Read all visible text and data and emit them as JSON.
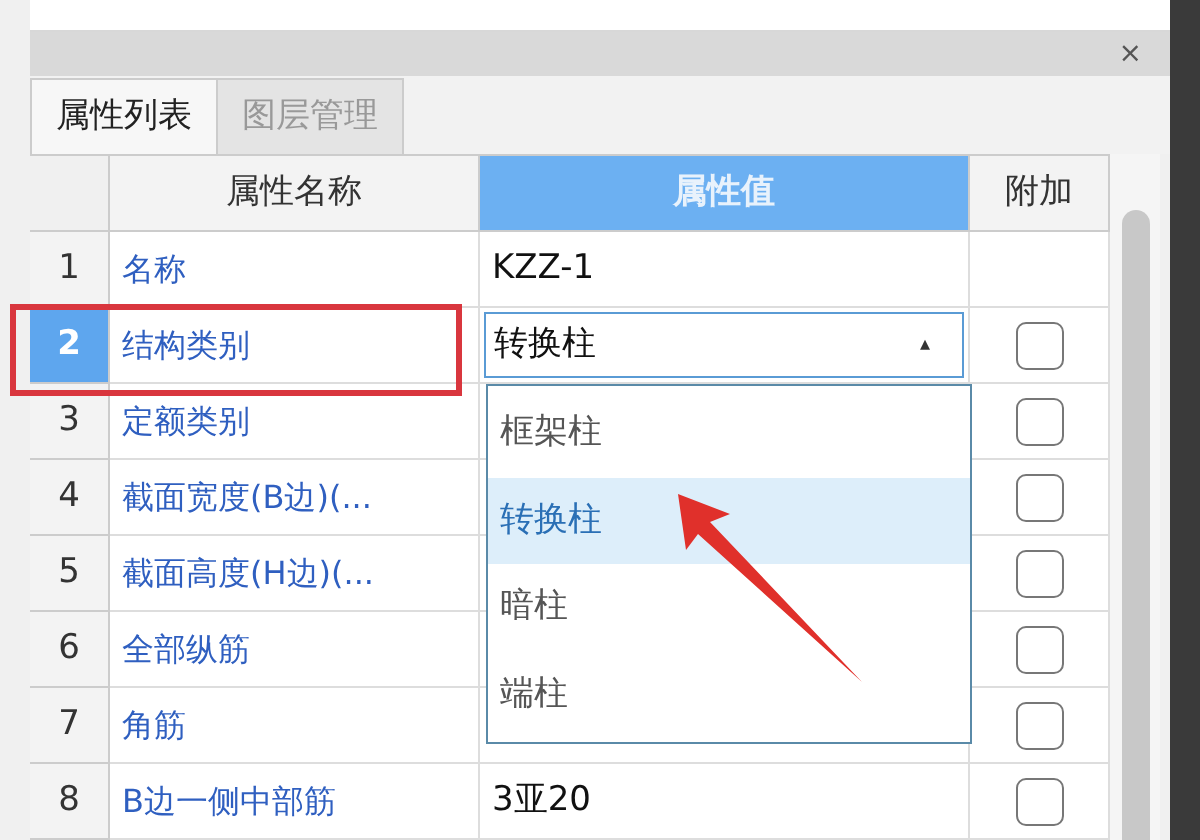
{
  "panel": {
    "close": "×"
  },
  "tabs": [
    {
      "label": "属性列表",
      "selected": true
    },
    {
      "label": "图层管理",
      "selected": false
    }
  ],
  "table": {
    "columns": [
      {
        "label": "属性名称",
        "selected": false
      },
      {
        "label": "属性值",
        "selected": true
      },
      {
        "label": "附加",
        "selected": false
      }
    ],
    "rows": [
      {
        "num": "1",
        "name": "名称",
        "value": "KZZ-1",
        "selected": false
      },
      {
        "num": "2",
        "name": "结构类别",
        "value": "转换柱",
        "selected": true,
        "checked": false
      },
      {
        "num": "3",
        "name": "定额类别",
        "selected": false,
        "checked": false
      },
      {
        "num": "4",
        "name": "截面宽度(B边)(...",
        "selected": false,
        "checked": false
      },
      {
        "num": "5",
        "name": "截面高度(H边)(...",
        "selected": false,
        "checked": false
      },
      {
        "num": "6",
        "name": "全部纵筋",
        "selected": false,
        "checked": false
      },
      {
        "num": "7",
        "name": "角筋",
        "selected": false,
        "checked": false
      },
      {
        "num": "8",
        "name": "B边一侧中部筋",
        "value": "3亚20",
        "selected": false,
        "checked": false
      }
    ]
  },
  "dropdown": {
    "arrow": "▴",
    "options": [
      {
        "label": "框架柱",
        "selected": false
      },
      {
        "label": "转换柱",
        "selected": true
      },
      {
        "label": "暗柱",
        "selected": false
      },
      {
        "label": "端柱",
        "selected": false
      }
    ]
  }
}
